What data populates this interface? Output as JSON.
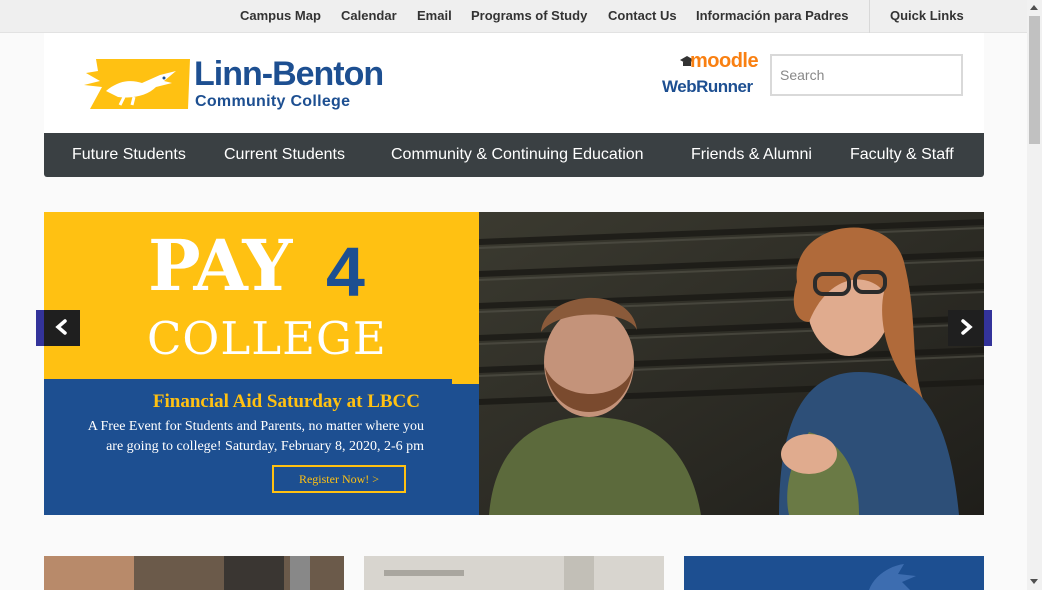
{
  "utility_nav": {
    "items": [
      "Campus Map",
      "Calendar",
      "Email",
      "Programs of Study",
      "Contact Us",
      "Información para Padres"
    ],
    "quick_links": "Quick Links"
  },
  "header": {
    "logo_name": "Linn-Benton",
    "logo_sub": "Community College",
    "moodle_label": "moodle",
    "webrunner_label": "WebRunner",
    "search_placeholder": "Search"
  },
  "main_nav": {
    "items": [
      "Future Students",
      "Current Students",
      "Community & Continuing Education",
      "Friends & Alumni",
      "Faculty & Staff"
    ]
  },
  "hero": {
    "pay": "PAY",
    "four": "4",
    "college": "COLLEGE",
    "event_title": "Financial Aid Saturday at LBCC",
    "event_desc": "A Free Event for Students and Parents, no matter where you are going to college!  Saturday, February 8, 2020, 2-6 pm",
    "cta": "Register Now! >"
  },
  "carousel_controls": {
    "prev_icon": "chevron-left-icon",
    "next_icon": "chevron-right-icon"
  },
  "colors": {
    "brand_blue": "#1d4f91",
    "brand_gold": "#ffc112",
    "nav_dark": "#3a4043"
  }
}
